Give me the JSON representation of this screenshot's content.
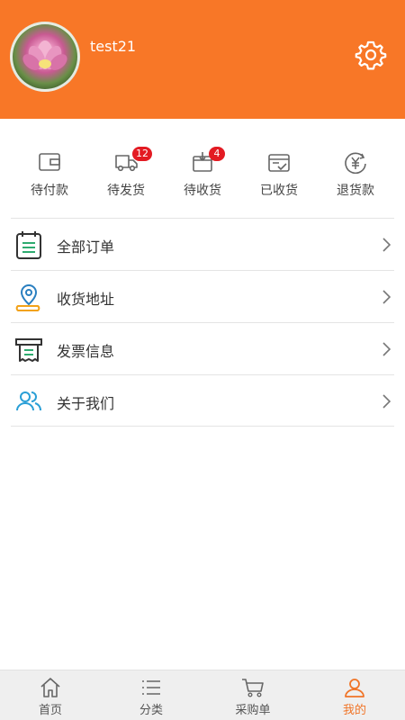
{
  "profile": {
    "username": "test21",
    "settings_icon": "gear-icon"
  },
  "orders": [
    {
      "label": "待付款",
      "icon": "wallet-icon",
      "badge": null
    },
    {
      "label": "待发货",
      "icon": "truck-icon",
      "badge": "12"
    },
    {
      "label": "待收货",
      "icon": "box-icon",
      "badge": "4"
    },
    {
      "label": "已收货",
      "icon": "received-icon",
      "badge": null
    },
    {
      "label": "退货款",
      "icon": "refund-icon",
      "badge": null
    }
  ],
  "menu": [
    {
      "label": "全部订单",
      "icon": "order-list-icon"
    },
    {
      "label": "收货地址",
      "icon": "location-icon"
    },
    {
      "label": "发票信息",
      "icon": "invoice-icon"
    },
    {
      "label": "关于我们",
      "icon": "people-icon"
    }
  ],
  "tabbar": [
    {
      "label": "首页",
      "icon": "home-icon"
    },
    {
      "label": "分类",
      "icon": "category-icon"
    },
    {
      "label": "采购单",
      "icon": "cart-icon"
    },
    {
      "label": "我的",
      "icon": "user-icon",
      "active": true
    }
  ],
  "colors": {
    "header_bg": "#f87727",
    "accent": "#f07427",
    "badge": "#e31b23"
  }
}
